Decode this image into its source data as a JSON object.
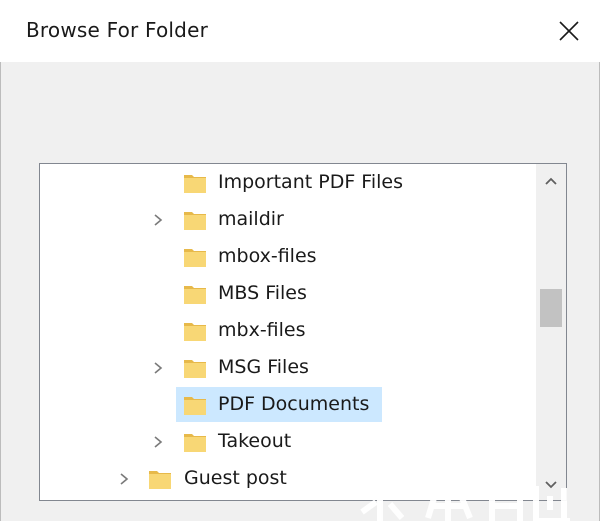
{
  "dialog": {
    "title": "Browse For Folder",
    "close_icon": "close-icon"
  },
  "tree": {
    "items": [
      {
        "label": "Important PDF Files",
        "has_children": false,
        "level": 2,
        "selected": false
      },
      {
        "label": "maildir",
        "has_children": true,
        "level": 2,
        "selected": false
      },
      {
        "label": "mbox-files",
        "has_children": false,
        "level": 2,
        "selected": false
      },
      {
        "label": "MBS Files",
        "has_children": false,
        "level": 2,
        "selected": false
      },
      {
        "label": "mbx-files",
        "has_children": false,
        "level": 2,
        "selected": false
      },
      {
        "label": "MSG Files",
        "has_children": true,
        "level": 2,
        "selected": false
      },
      {
        "label": "PDF Documents",
        "has_children": false,
        "level": 2,
        "selected": true
      },
      {
        "label": "Takeout",
        "has_children": true,
        "level": 2,
        "selected": false
      },
      {
        "label": "Guest post",
        "has_children": true,
        "level": 1,
        "selected": false
      }
    ]
  },
  "colors": {
    "selection": "#cce8ff",
    "folder": "#f8d775",
    "folder_dark": "#e7b94a",
    "text": "#1a1a1a"
  },
  "icons": {
    "folder": "folder-icon",
    "expand": "chevron-right-icon",
    "scroll_up": "chevron-up-icon",
    "scroll_down": "chevron-down-icon"
  }
}
